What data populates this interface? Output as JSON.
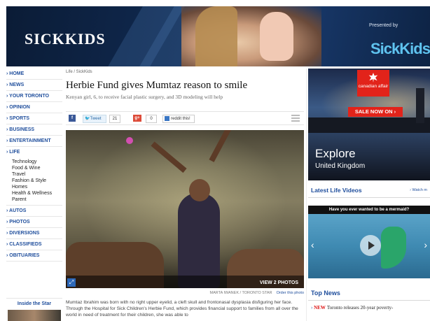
{
  "banner": {
    "title": "SICKKIDS",
    "presented_by": "Presented by",
    "brand": "SickKids"
  },
  "nav": {
    "items": [
      {
        "label": "HOME"
      },
      {
        "label": "NEWS"
      },
      {
        "label": "YOUR TORONTO"
      },
      {
        "label": "OPINION"
      },
      {
        "label": "SPORTS"
      },
      {
        "label": "BUSINESS"
      },
      {
        "label": "ENTERTAINMENT"
      },
      {
        "label": "LIFE"
      }
    ],
    "life_sub": [
      "Technology",
      "Food & Wine",
      "Travel",
      "Fashion & Style",
      "Homes",
      "Health & Wellness",
      "Parent"
    ],
    "items_after": [
      {
        "label": "AUTOS"
      },
      {
        "label": "PHOTOS"
      },
      {
        "label": "DIVERSIONS"
      },
      {
        "label": "CLASSIFIEDS"
      },
      {
        "label": "OBITUARIES"
      }
    ],
    "inside": "Inside the Star"
  },
  "article": {
    "breadcrumb": "Life / SickKids",
    "headline": "Herbie Fund gives Mumtaz reason to smile",
    "dek": "Kenyan girl, 6, to receive facial plastic surgery, and 3D modeling will help",
    "share": {
      "facebook": "f",
      "tweet": "Tweet",
      "tweet_count": "21",
      "gplus": "g+",
      "gplus_count": "0",
      "reddit": "reddit this!"
    },
    "photo": {
      "view_label": "VIEW 2 PHOTOS",
      "credit": "MARTA IWANEK / TORONTO STAR",
      "order": "Order this photo"
    },
    "body": "Mumtaz Ibrahim was born with no right upper eyelid, a cleft skull and frontonasal dysplasia disfiguring her face. Through the Hospital for Sick Children's Herbie Fund, which provides financial support to families from all over the world in need of treatment for their children, she was able to"
  },
  "ad": {
    "logo_text": "canadian affair",
    "sale": "SALE NOW ON ›",
    "headline": "Explore",
    "sub": "United Kingdom"
  },
  "videos": {
    "title": "Latest Life Videos",
    "watch": "› Watch m",
    "caption": "Have you ever wanted to be a mermaid?"
  },
  "topnews": {
    "title": "Top News",
    "items": [
      {
        "tag": "NEW",
        "text": "Toronto releases 20-year poverty-"
      }
    ]
  },
  "colors": {
    "nav_blue": "#1f4e9c",
    "banner_navy": "#0d2344",
    "brand_cyan": "#5fc3ef",
    "ad_red": "#e2231a"
  }
}
